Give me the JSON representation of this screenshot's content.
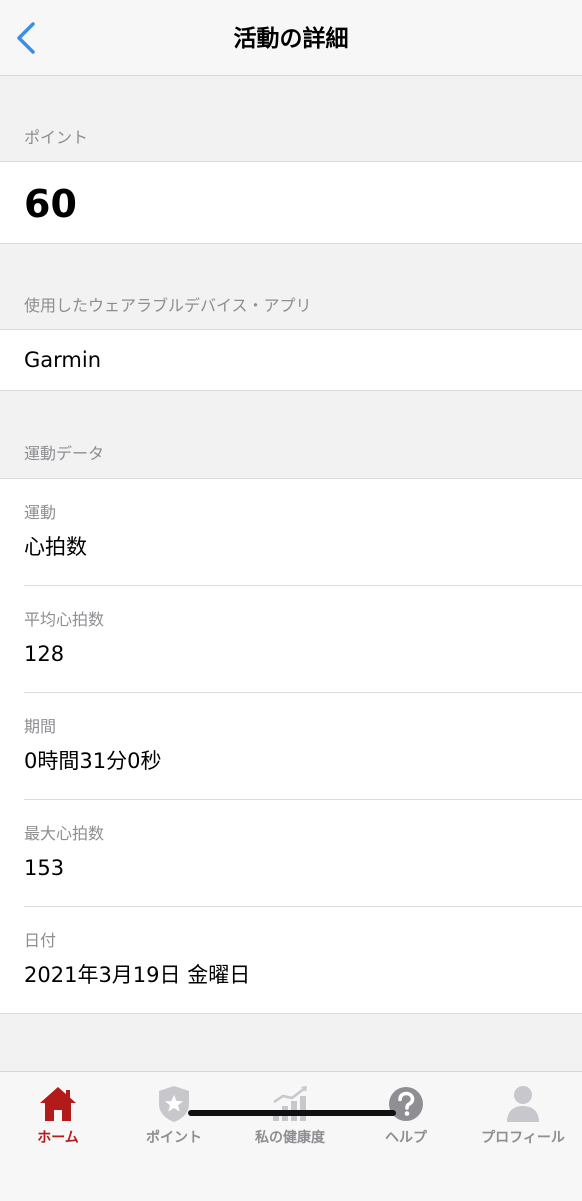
{
  "header": {
    "title": "活動の詳細",
    "back_icon": "chevron-left-icon"
  },
  "points_section": {
    "label": "ポイント",
    "value": "60"
  },
  "device_section": {
    "label": "使用したウェアラブルデバイス・アプリ",
    "value": "Garmin"
  },
  "exercise_section": {
    "label": "運動データ",
    "rows": [
      {
        "label": "運動",
        "value": "心拍数"
      },
      {
        "label": "平均心拍数",
        "value": "128"
      },
      {
        "label": "期間",
        "value": "0時間31分0秒"
      },
      {
        "label": "最大心拍数",
        "value": "153"
      },
      {
        "label": "日付",
        "value": "2021年3月19日 金曜日"
      }
    ]
  },
  "tabbar": {
    "tabs": [
      {
        "label": "ホーム",
        "icon": "home-icon",
        "active": true
      },
      {
        "label": "ポイント",
        "icon": "shield-star-icon",
        "active": false
      },
      {
        "label": "私の健康度",
        "icon": "bar-chart-icon",
        "active": false
      },
      {
        "label": "ヘルプ",
        "icon": "help-icon",
        "active": false
      },
      {
        "label": "プロフィール",
        "icon": "profile-icon",
        "active": false
      }
    ]
  },
  "colors": {
    "accent_active": "#b31b1b",
    "back_arrow": "#3a8ee6",
    "inactive": "#8e8e93"
  }
}
